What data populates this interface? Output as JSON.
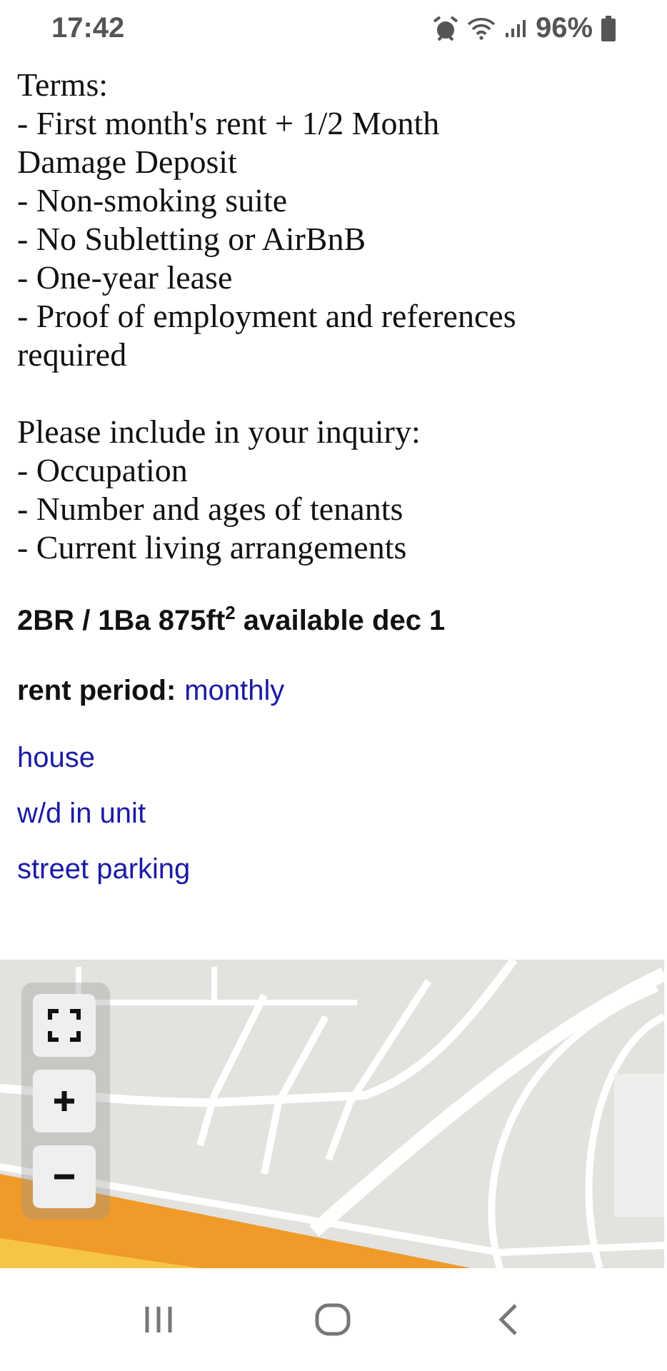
{
  "status_bar": {
    "time": "17:42",
    "battery": "96%"
  },
  "terms": {
    "heading": "Terms:",
    "items": [
      "- First month's rent + 1/2 Month\nDamage Deposit",
      "- Non-smoking suite",
      "- No Subletting or AirBnB",
      "- One-year lease",
      "- Proof of employment and references\nrequired"
    ]
  },
  "inquiry": {
    "heading": "Please include in your inquiry:",
    "items": [
      "- Occupation",
      "- Number and ages of tenants",
      "- Current living arrangements"
    ]
  },
  "attributes": {
    "summary": "2BR / 1Ba 875ft$^{2}$ available dec 1",
    "rent_label": "rent period:",
    "rent_value": "monthly",
    "links": [
      "house",
      "w/d in unit",
      "street parking"
    ]
  },
  "map": {
    "kind": "picture",
    "controls": [
      {
        "kind": "fullscreen"
      },
      {
        "kind": "zoom_in"
      },
      {
        "kind": "zoom_out"
      }
    ]
  },
  "nav_bar": {
    "buttons": [
      {
        "kind": "recents"
      },
      {
        "kind": "home"
      },
      {
        "kind": "back"
      }
    ]
  }
}
